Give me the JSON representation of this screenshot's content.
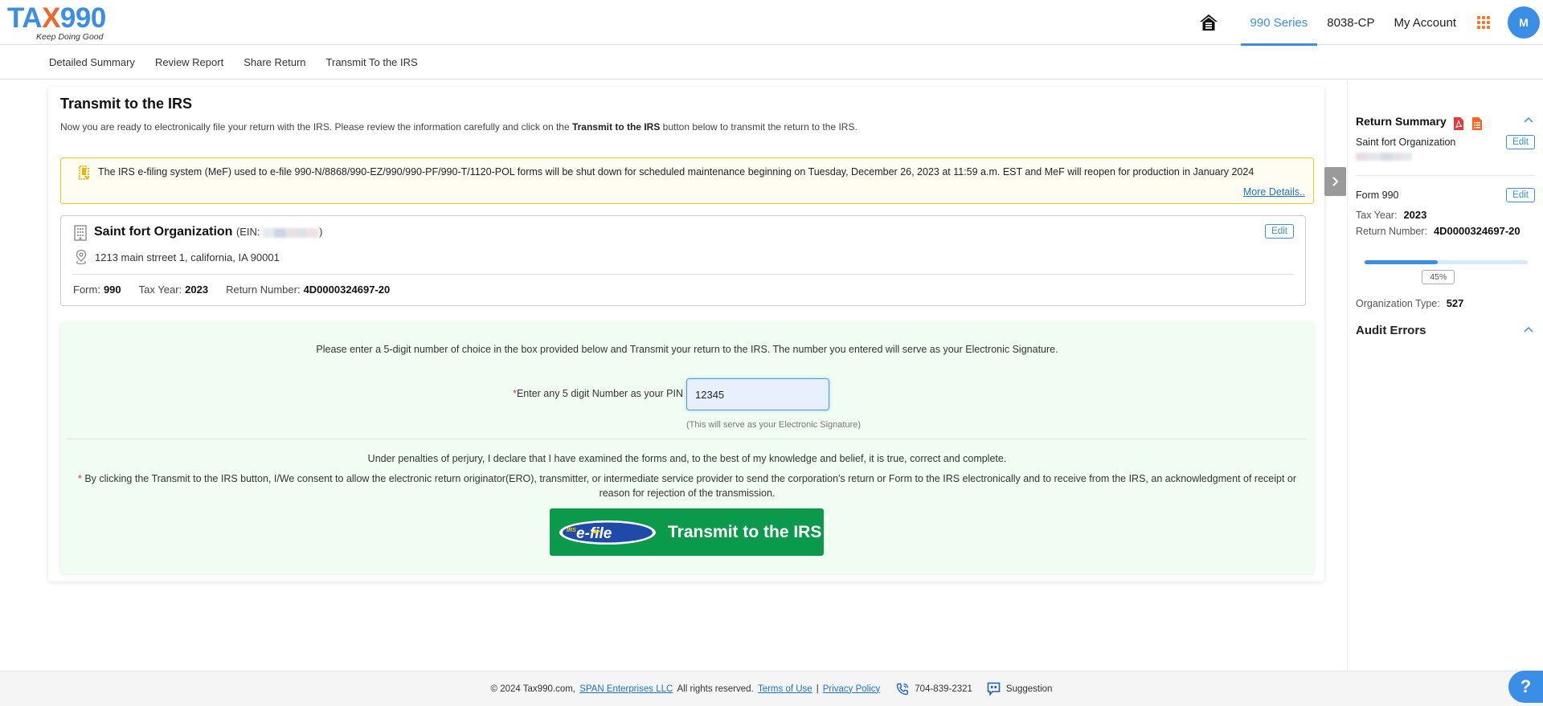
{
  "header": {
    "logo_text_a": "TA",
    "logo_text_x": "X",
    "logo_text_b": "990",
    "logo_tagline": "Keep Doing Good",
    "nav": [
      {
        "label": "990 Series",
        "active": true
      },
      {
        "label": "8038-CP",
        "active": false
      },
      {
        "label": "My Account",
        "active": false
      }
    ],
    "avatar_initial": "M"
  },
  "subnav": {
    "items": [
      "Detailed Summary",
      "Review Report",
      "Share Return",
      "Transmit To the IRS"
    ]
  },
  "main": {
    "title": "Transmit to the IRS",
    "intro_before": "Now you are ready to electronically file your return with the IRS. Please review the information carefully and click on the ",
    "intro_bold": "Transmit to the IRS",
    "intro_after": " button below to transmit the return to the IRS.",
    "alert": {
      "text": "The IRS e-filing system (MeF) used to e-file 990-N/8868/990-EZ/990/990-PF/990-T/1120-POL forms will be shut down for scheduled maintenance beginning on Tuesday, December 26, 2023 at 11:59 a.m. EST and MeF will reopen for production in January 2024",
      "link": "More Details.."
    },
    "organization": {
      "name": "Saint fort Organization",
      "ein_prefix": "(EIN: ",
      "ein_suffix": ")",
      "address": "1213 main strreet 1, california, IA 90001",
      "edit_label": "Edit",
      "form_label": "Form:",
      "form_value": "990",
      "tax_year_label": "Tax Year:",
      "tax_year_value": "2023",
      "return_number_label": "Return Number:",
      "return_number_value": "4D0000324697-20"
    },
    "signature": {
      "intro": "Please enter a 5-digit number of choice in the box provided below and Transmit your return to the IRS. The number you entered will serve as your Electronic Signature.",
      "required_mark": "*",
      "pin_label": "Enter any 5 digit Number as your PIN",
      "pin_value": "12345",
      "pin_hint": "(This will serve as your Electronic Signature)",
      "perjury": "Under penalties of perjury, I declare that I have examined the forms and, to the best of my knowledge and belief, it is true, correct and complete.",
      "consent": "By clicking the Transmit to the IRS button, I/We consent to allow the electronic return originator(ERO), transmitter, or intermediate service provider to send the corporation's return or Form to the IRS electronically and to receive from the IRS, an acknowledgment of receipt or reason for rejection of the transmission.",
      "efile_logo_irs": "IRS",
      "efile_logo_text": "e-file",
      "transmit_label": "Transmit to the IRS"
    }
  },
  "sidebar": {
    "title": "Return Summary",
    "org_name": "Saint fort Organization",
    "edit_label": "Edit",
    "form_label": "Form 990",
    "tax_year_label": "Tax Year:",
    "tax_year_value": "2023",
    "return_number_label": "Return Number:",
    "return_number_value": "4D0000324697-20",
    "progress_percent": 45,
    "progress_label": "45%",
    "org_type_label": "Organization Type:",
    "org_type_value": "527",
    "audit_title": "Audit Errors"
  },
  "footer": {
    "copyright": "© 2024 Tax990.com,",
    "company_link": "SPAN Enterprises LLC",
    "rights": "All rights reserved.",
    "terms_link": "Terms of Use",
    "separator": "|",
    "privacy_link": "Privacy Policy",
    "phone": "704-839-2321",
    "suggestion": "Suggestion"
  },
  "help_label": "?",
  "colors": {
    "brand_blue": "#3a8ee6",
    "brand_orange": "#e7692b",
    "transmit_green": "#0b9a4b",
    "alert_border": "#f3c623",
    "panel_green_bg": "#f1fdf3"
  }
}
